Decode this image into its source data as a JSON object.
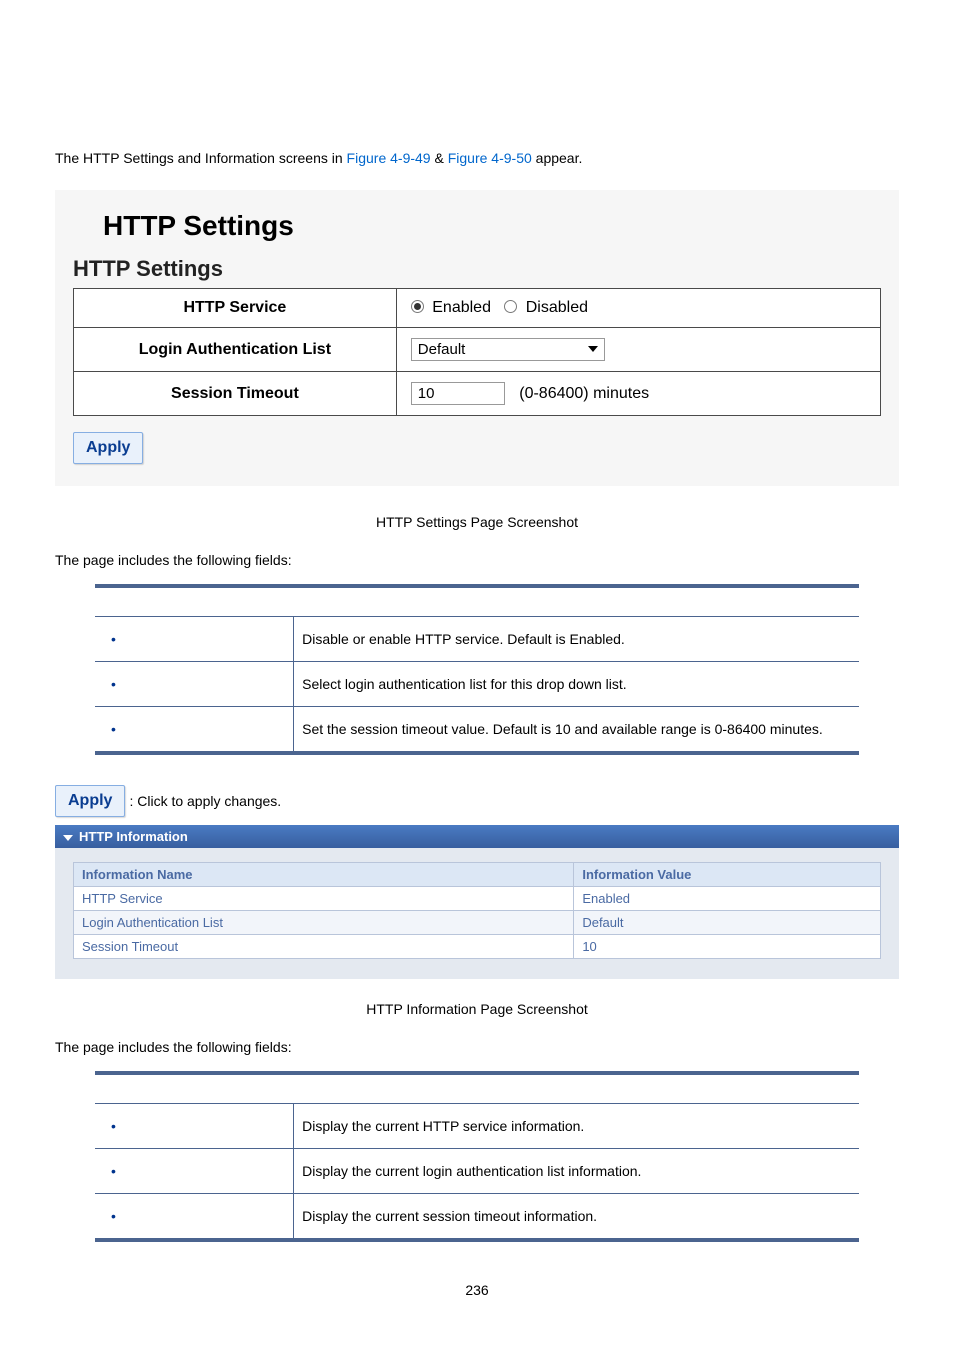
{
  "intro": {
    "prefix": "The HTTP Settings and Information screens in ",
    "link1": "Figure 4-9-49",
    "amp": " & ",
    "link2": "Figure 4-9-50",
    "suffix": " appear."
  },
  "settings_panel": {
    "title": "HTTP Settings",
    "subtitle": "HTTP Settings",
    "rows": {
      "http_service_label": "HTTP Service",
      "http_service_opt_enabled": " Enabled ",
      "http_service_opt_disabled": " Disabled",
      "login_auth_label": "Login Authentication List",
      "login_auth_value": "Default",
      "session_timeout_label": "Session Timeout",
      "session_timeout_value": "10",
      "session_timeout_unit": "(0-86400) minutes"
    },
    "apply_label": "Apply"
  },
  "caption1": "HTTP Settings Page Screenshot",
  "fields_intro": "The page includes the following fields:",
  "fields1_headers": {
    "object": "",
    "description": ""
  },
  "fields1": [
    {
      "object": "",
      "description": "Disable or enable HTTP service. Default is Enabled."
    },
    {
      "object": "",
      "description": "Select login authentication list for this drop down list."
    },
    {
      "object": "",
      "description": "Set the session timeout value. Default is 10 and available range is 0-86400 minutes."
    }
  ],
  "apply_note": "Click to apply changes.",
  "apply_btn2": "Apply",
  "info_panel": {
    "header": "HTTP Information",
    "col_name": "Information Name",
    "col_value": "Information Value",
    "rows": [
      {
        "name": "HTTP Service",
        "value": "Enabled"
      },
      {
        "name": "Login Authentication List",
        "value": "Default"
      },
      {
        "name": "Session Timeout",
        "value": "10"
      }
    ]
  },
  "caption2": "HTTP Information Page Screenshot",
  "fields2": [
    {
      "object": "",
      "description": "Display the current HTTP service information."
    },
    {
      "object": "",
      "description": "Display the current login authentication list information."
    },
    {
      "object": "",
      "description": "Display the current session timeout information."
    }
  ],
  "page_number": "236"
}
